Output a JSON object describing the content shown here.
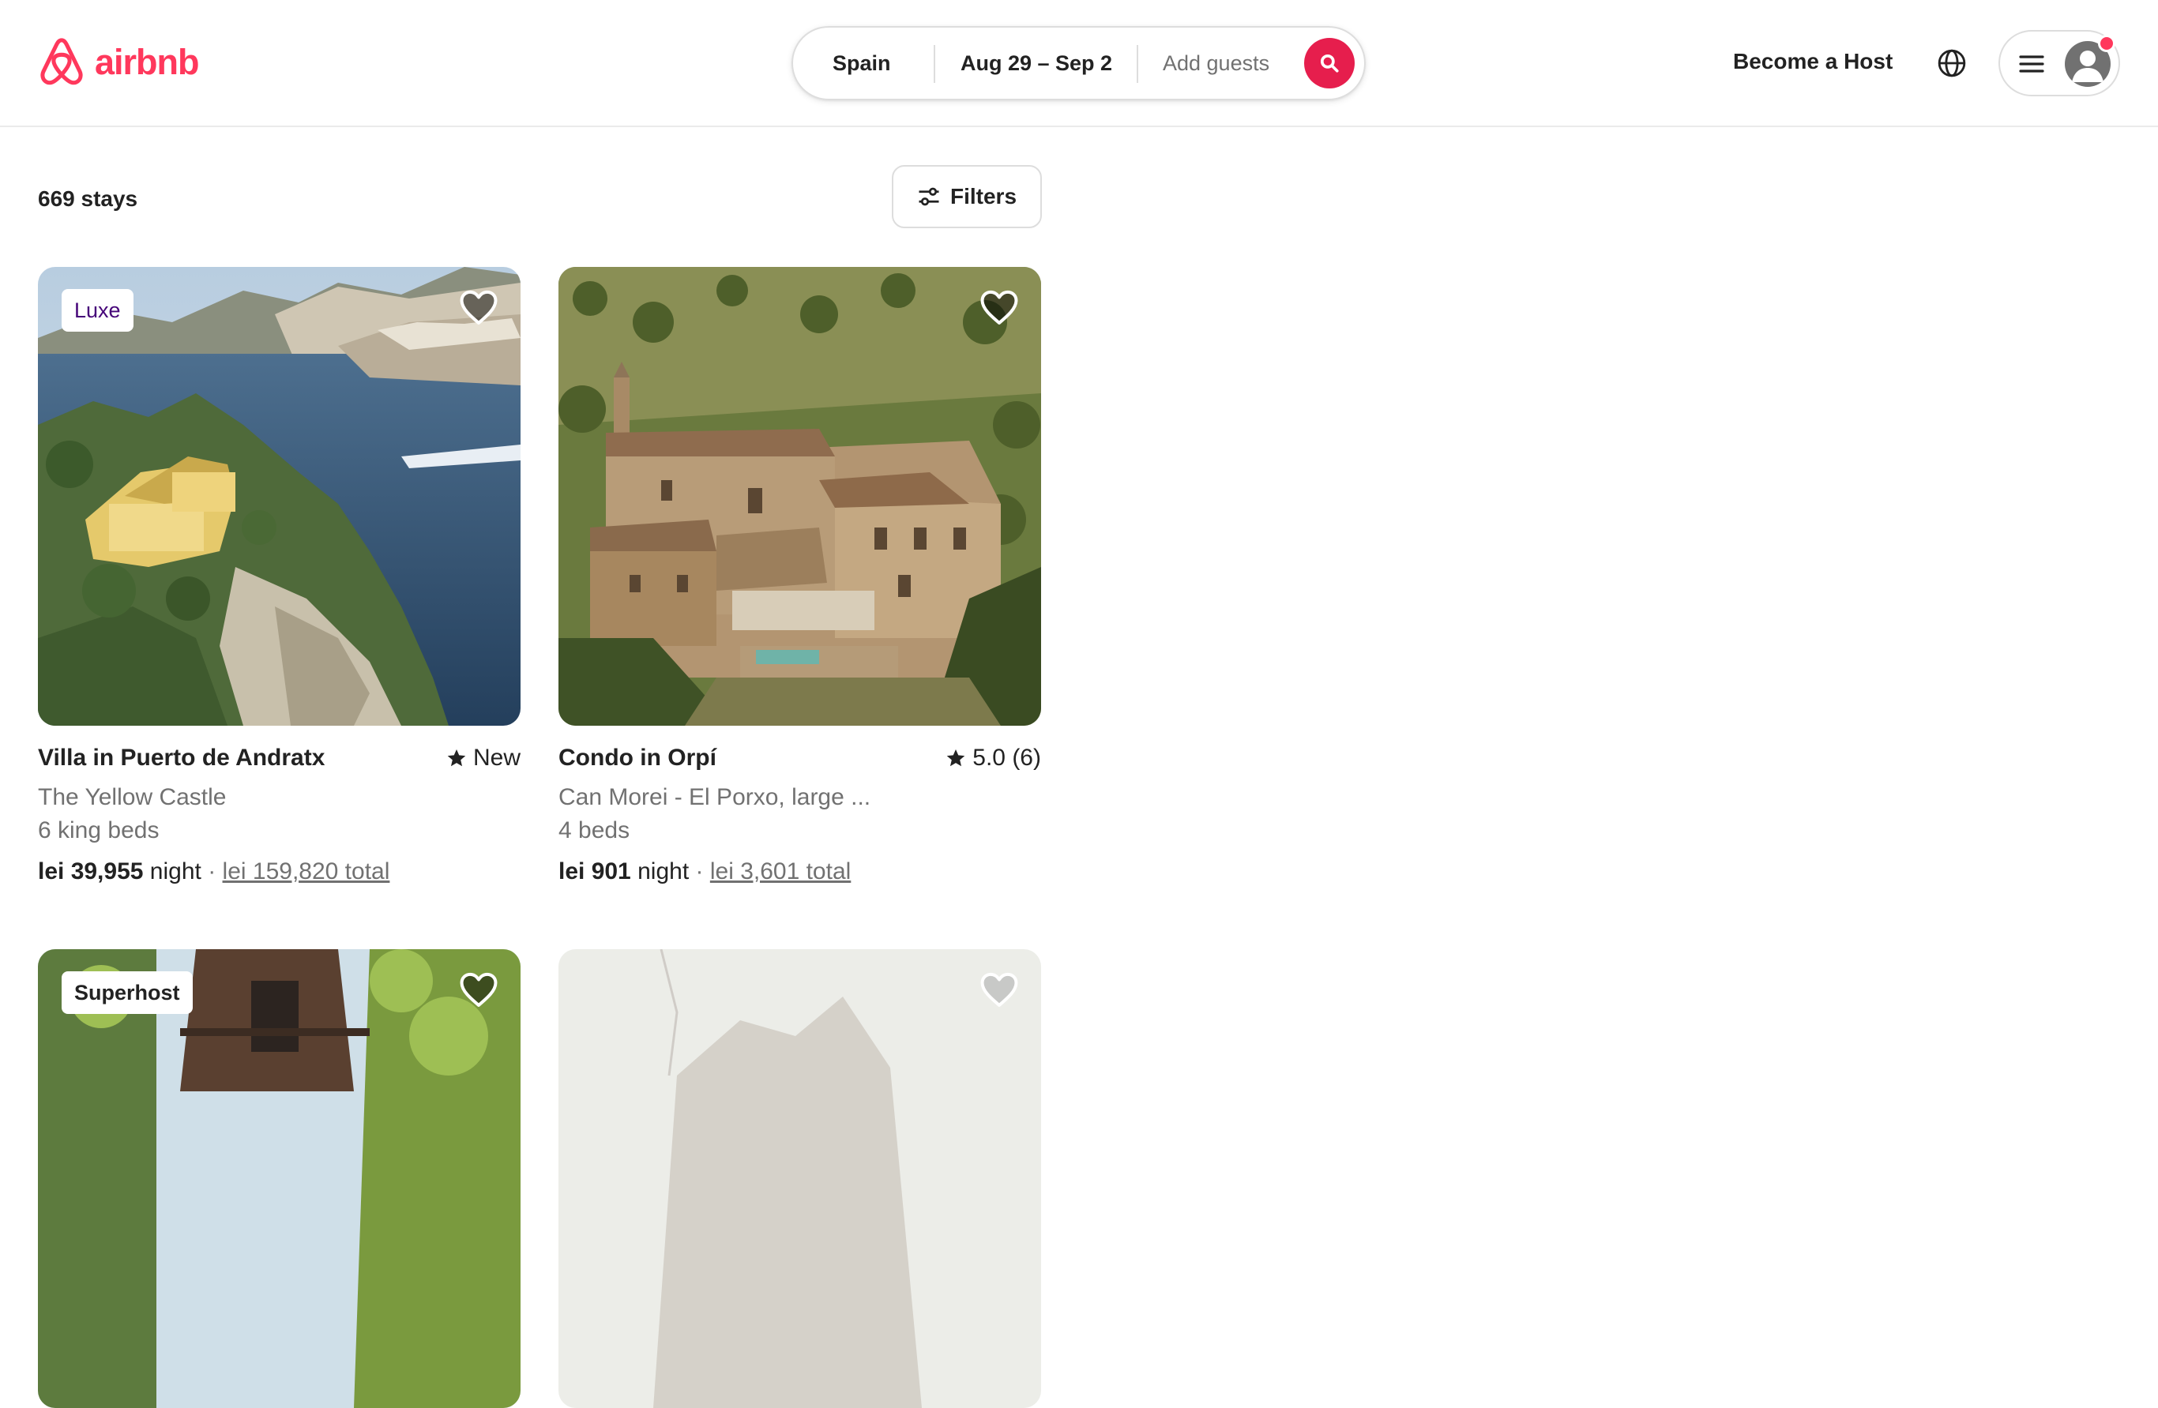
{
  "brand": {
    "name": "airbnb",
    "color": "#ff385c",
    "icon": "airbnb-logo-icon"
  },
  "search": {
    "location": "Spain",
    "dates": "Aug 29 – Sep 2",
    "guests_placeholder": "Add guests",
    "button_icon": "search-icon",
    "button_color": "#e61e4d"
  },
  "nav": {
    "become_host": "Become a Host",
    "language_icon": "globe-icon",
    "menu_icon": "hamburger-menu-icon",
    "avatar_icon": "user-avatar-icon",
    "notification_color": "#ff385c"
  },
  "results": {
    "count_label": "669 stays",
    "filters_label": "Filters",
    "filters_icon": "sliders-icon"
  },
  "listings": [
    {
      "badge": "Luxe",
      "title": "Villa in Puerto de Andratx",
      "rating": "New",
      "subtitle": "The Yellow Castle",
      "beds": "6 king beds",
      "price": "lei 39,955",
      "price_unit": "night",
      "total": "lei 159,820 total"
    },
    {
      "badge": "",
      "title": "Condo in Orpí",
      "rating": "5.0 (6)",
      "subtitle": "Can Morei - El Porxo, large ...",
      "beds": "4 beds",
      "price": "lei 901",
      "price_unit": "night",
      "total": "lei 3,601 total"
    },
    {
      "badge": "Superhost"
    },
    {
      "badge": ""
    }
  ]
}
